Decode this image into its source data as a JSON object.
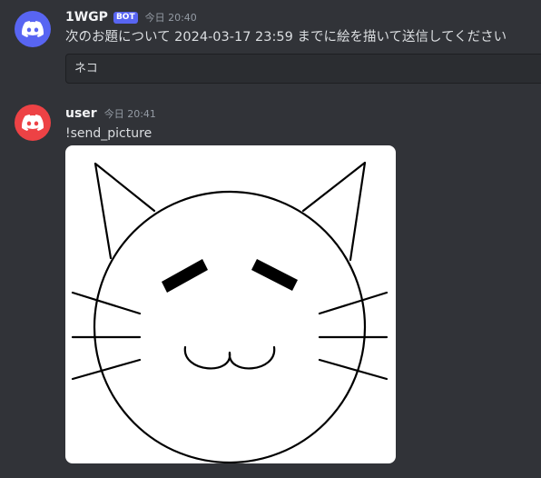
{
  "messages": [
    {
      "username": "1WGP",
      "bot_tag": "BOT",
      "timestamp": "今日 20:40",
      "content": "次のお題について 2024-03-17 23:59 までに絵を描いて送信してください",
      "embed_text": "ネコ",
      "avatar_icon": "discord-logo-icon",
      "avatar_color": "#5865f2"
    },
    {
      "username": "user",
      "timestamp": "今日 20:41",
      "content": "!send_picture",
      "avatar_icon": "discord-logo-icon",
      "avatar_color": "#ed4245",
      "attachment_icon": "cat-face-drawing"
    }
  ],
  "colors": {
    "background": "#313338",
    "embed_background": "#2b2d31",
    "bot_tag": "#5865f2",
    "timestamp": "#949ba4",
    "text": "#dbdee1"
  }
}
